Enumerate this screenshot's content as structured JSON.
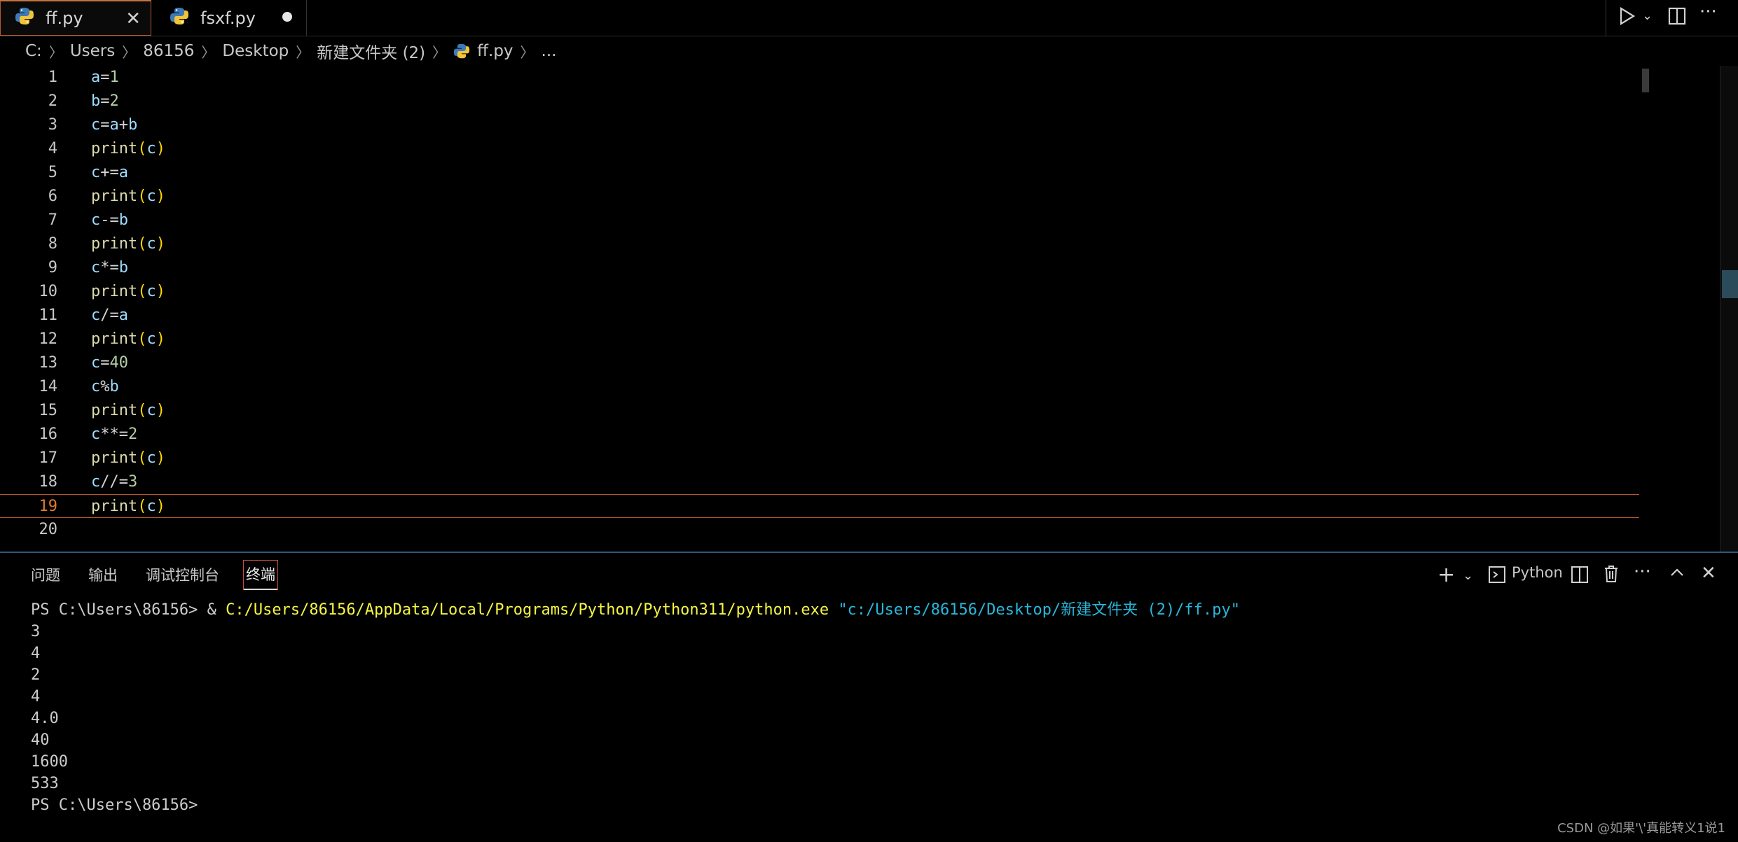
{
  "tabs": [
    {
      "label": "ff.py",
      "active": true,
      "dirty": false
    },
    {
      "label": "fsxf.py",
      "active": false,
      "dirty": true
    }
  ],
  "breadcrumb": [
    "C:",
    "Users",
    "86156",
    "Desktop",
    "新建文件夹 (2)",
    "ff.py",
    "..."
  ],
  "editor": {
    "current_line": 19,
    "lines": [
      {
        "n": "1",
        "code": "a=1"
      },
      {
        "n": "2",
        "code": "b=2"
      },
      {
        "n": "3",
        "code": "c=a+b"
      },
      {
        "n": "4",
        "code": "print(c)"
      },
      {
        "n": "5",
        "code": "c+=a"
      },
      {
        "n": "6",
        "code": "print(c)"
      },
      {
        "n": "7",
        "code": "c-=b"
      },
      {
        "n": "8",
        "code": "print(c)"
      },
      {
        "n": "9",
        "code": "c*=b"
      },
      {
        "n": "10",
        "code": "print(c)"
      },
      {
        "n": "11",
        "code": "c/=a"
      },
      {
        "n": "12",
        "code": "print(c)"
      },
      {
        "n": "13",
        "code": "c=40"
      },
      {
        "n": "14",
        "code": "c%b"
      },
      {
        "n": "15",
        "code": "print(c)"
      },
      {
        "n": "16",
        "code": "c**=2"
      },
      {
        "n": "17",
        "code": "print(c)"
      },
      {
        "n": "18",
        "code": "c//=3"
      },
      {
        "n": "19",
        "code": "print(c)"
      },
      {
        "n": "20",
        "code": ""
      }
    ]
  },
  "panel": {
    "tabs": {
      "problems": "问题",
      "output": "输出",
      "debug_console": "调试控制台",
      "terminal": "终端"
    },
    "terminal_profile": "Python"
  },
  "terminal": {
    "command": {
      "prompt": "PS C:\\Users\\86156> ",
      "amp": "& ",
      "exe": "C:/Users/86156/AppData/Local/Programs/Python/Python311/python.exe",
      "script": " \"c:/Users/86156/Desktop/新建文件夹 (2)/ff.py\""
    },
    "output": [
      "3",
      "4",
      "2",
      "4",
      "4.0",
      "40",
      "1600",
      "533"
    ],
    "final_prompt": "PS C:\\Users\\86156>"
  },
  "watermark": "CSDN @如果'\\'真能转义1说1",
  "colors": {
    "accent": "#c8733d",
    "variable": "#9cdcfe",
    "function": "#dcdcaa",
    "bracket": "#ffd700",
    "terminal_yellow": "#f5f543",
    "terminal_cyan": "#29b8db"
  }
}
